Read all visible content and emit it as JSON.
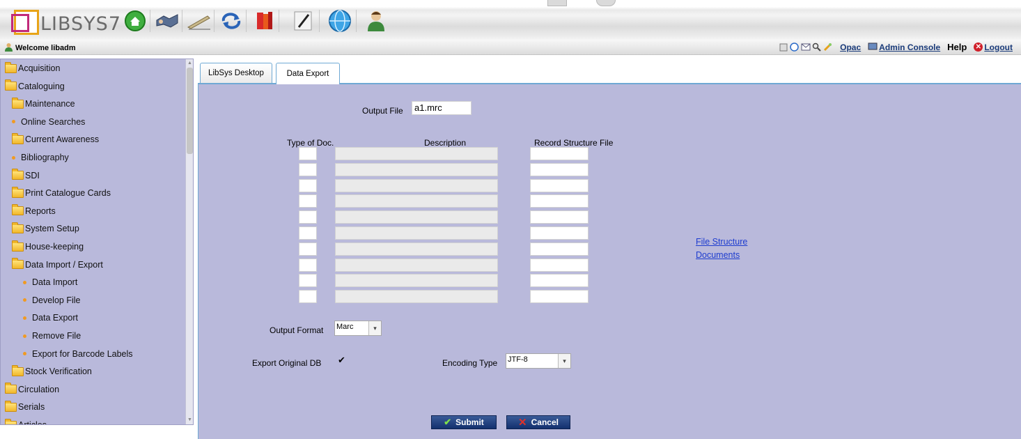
{
  "toolbar": {
    "logo_text": "LIBSYS7",
    "icons": [
      "home-icon",
      "handshake-icon",
      "pen-icon",
      "refresh-icon",
      "books-icon",
      "pencil-icon",
      "globe-icon",
      "user-icon"
    ]
  },
  "welcome": {
    "text": "Welcome libadm",
    "opac": "Opac",
    "admin_console": "Admin Console",
    "help": "Help",
    "logout": "Logout"
  },
  "sidebar": {
    "items": [
      {
        "label": "Acquisition",
        "type": "folder",
        "level": 0
      },
      {
        "label": "Cataloguing",
        "type": "folder",
        "level": 0
      },
      {
        "label": "Maintenance",
        "type": "folder",
        "level": 1
      },
      {
        "label": "Online Searches",
        "type": "dot",
        "level": 1
      },
      {
        "label": "Current Awareness",
        "type": "folder",
        "level": 1
      },
      {
        "label": "Bibliography",
        "type": "dot",
        "level": 1
      },
      {
        "label": "SDI",
        "type": "folder",
        "level": 1
      },
      {
        "label": "Print Catalogue Cards",
        "type": "folder",
        "level": 1
      },
      {
        "label": "Reports",
        "type": "folder",
        "level": 1
      },
      {
        "label": "System Setup",
        "type": "folder",
        "level": 1
      },
      {
        "label": "House-keeping",
        "type": "folder",
        "level": 1
      },
      {
        "label": "Data Import / Export",
        "type": "folder",
        "level": 1
      },
      {
        "label": "Data Import",
        "type": "dot",
        "level": 2
      },
      {
        "label": "Develop File",
        "type": "dot",
        "level": 2
      },
      {
        "label": "Data Export",
        "type": "dot",
        "level": 2
      },
      {
        "label": "Remove File",
        "type": "dot",
        "level": 2
      },
      {
        "label": "Export for Barcode Labels",
        "type": "dot",
        "level": 2
      },
      {
        "label": "Stock Verification",
        "type": "folder",
        "level": 1
      },
      {
        "label": "Circulation",
        "type": "folder",
        "level": 0
      },
      {
        "label": "Serials",
        "type": "folder",
        "level": 0
      },
      {
        "label": "Articles",
        "type": "folder",
        "level": 0
      }
    ]
  },
  "tabs": [
    {
      "label": "LibSys Desktop",
      "active": false
    },
    {
      "label": "Data Export",
      "active": true
    }
  ],
  "form": {
    "output_file_label": "Output File",
    "output_file_value": "a1.mrc",
    "col_type": "Type of Doc.",
    "col_desc": "Description",
    "col_struct": "Record Structure File",
    "rows": 10,
    "link_line1": "File Structure",
    "link_line2": "Documents",
    "output_format_label": "Output Format",
    "output_format_value": "Marc",
    "export_db_label": "Export Original DB",
    "export_db_checked": true,
    "encoding_label": "Encoding Type",
    "encoding_value": "JTF-8",
    "submit_label": "Submit",
    "cancel_label": "Cancel"
  },
  "colors": {
    "panel_bg": "#b9b9db",
    "tab_border": "#6fa9d4",
    "button_bg": "#13306e",
    "link": "#1d3ccf"
  }
}
